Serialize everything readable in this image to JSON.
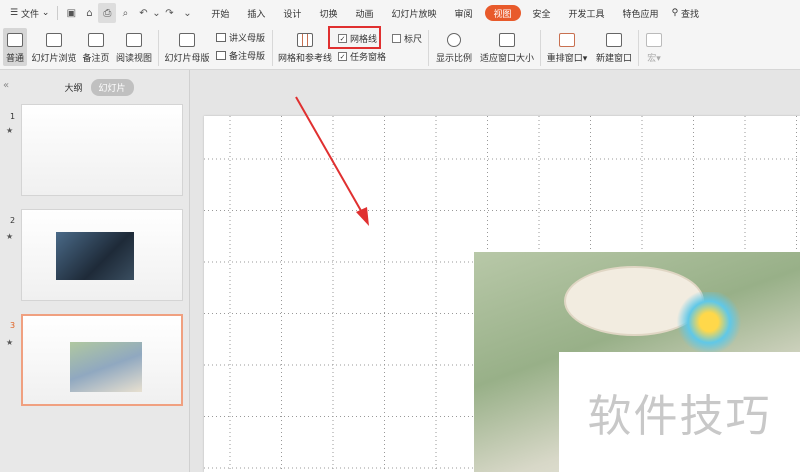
{
  "menubar": {
    "file_label": "文件",
    "search_label": "查找",
    "tabs": [
      "开始",
      "插入",
      "设计",
      "切换",
      "动画",
      "幻灯片放映",
      "审阅",
      "视图",
      "安全",
      "开发工具",
      "特色应用"
    ],
    "active_tab": "视图"
  },
  "ribbon": {
    "normal": "普通",
    "slide_sorter": "幻灯片浏览",
    "notes_page": "备注页",
    "reading_view": "阅读视图",
    "slide_master": "幻灯片母版",
    "handout_master": "讲义母版",
    "notes_master": "备注母版",
    "grid_guides": "网格和参考线",
    "gridlines": "网格线",
    "gridlines_checked": true,
    "ruler": "标尺",
    "ruler_checked": false,
    "task_pane": "任务窗格",
    "task_pane_checked": true,
    "zoom": "显示比例",
    "fit_window": "适应窗口大小",
    "arrange_window": "重排窗口",
    "new_window": "新建窗口",
    "macro": "宏"
  },
  "panel": {
    "tab_outline": "大纲",
    "tab_slides": "幻灯片",
    "slides": [
      {
        "num": "1"
      },
      {
        "num": "2"
      },
      {
        "num": "3"
      }
    ]
  },
  "watermark": "软件技巧",
  "colors": {
    "accent": "#e85a2b",
    "highlight": "#e03030"
  }
}
